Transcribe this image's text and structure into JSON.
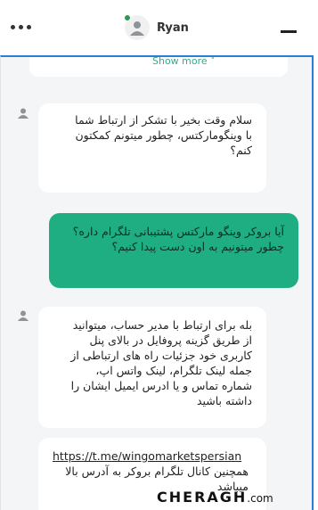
{
  "header": {
    "username": "Ryan",
    "menu_icon": "more-dots-icon",
    "minimize_icon": "minimize-icon",
    "status_color": "#2d9a4b"
  },
  "chat": {
    "show_more_label": "Show more ˅",
    "accent_color": "#1fad82",
    "messages": [
      {
        "from": "agent",
        "text": "سلام وقت بخیر با تشکر از ارتباط شما با وینگومارکتس، چطور میتونم کمکتون کنم؟"
      },
      {
        "from": "user",
        "text": "آیا بروکر وینگو مارکتس پشتیبانی تلگرام داره؟ چطور میتونیم به اون دست پیدا کنیم؟"
      },
      {
        "from": "agent",
        "text": "بله برای ارتباط با مدیر حساب، میتوانید از طریق گزینه پروفایل در بالای پنل کاربری خود جزئیات راه های ارتباطی از جمله لینک تلگرام، لینک واتس اپ، شماره تماس و یا ادرس ایمیل ایشان را داشته باشید"
      },
      {
        "from": "agent",
        "link": "https://t.me/wingomarketspersian",
        "text": "همچنین کانال تلگرام بروکر به آدرس بالا میباشد"
      }
    ]
  },
  "watermark": {
    "brand": "CHERAGH",
    "suffix": ".com"
  }
}
